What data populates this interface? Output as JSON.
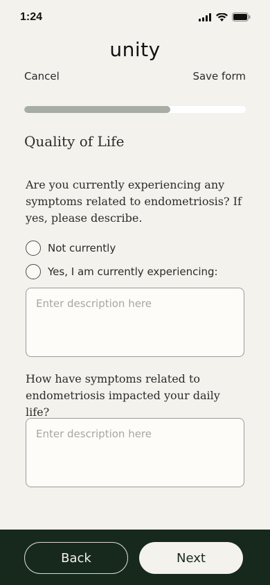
{
  "status_bar": {
    "time": "1:24"
  },
  "header": {
    "app_title": "unity",
    "cancel_label": "Cancel",
    "save_label": "Save form"
  },
  "progress": {
    "fraction": 0.66
  },
  "section": {
    "title": "Quality of Life"
  },
  "question_1": {
    "text": "Are you currently experiencing any symptoms related to endometriosis? If yes, please describe.",
    "options": [
      {
        "label": "Not currently"
      },
      {
        "label": "Yes, I am currently experiencing:"
      }
    ],
    "placeholder": "Enter description here"
  },
  "question_2": {
    "text": "How have symptoms related to endometriosis impacted your daily life?",
    "placeholder": "Enter description here"
  },
  "footer": {
    "back_label": "Back",
    "next_label": "Next"
  },
  "colors": {
    "background": "#f4f2ec",
    "footer": "#17291d",
    "progress_fill": "#a7aca4"
  }
}
